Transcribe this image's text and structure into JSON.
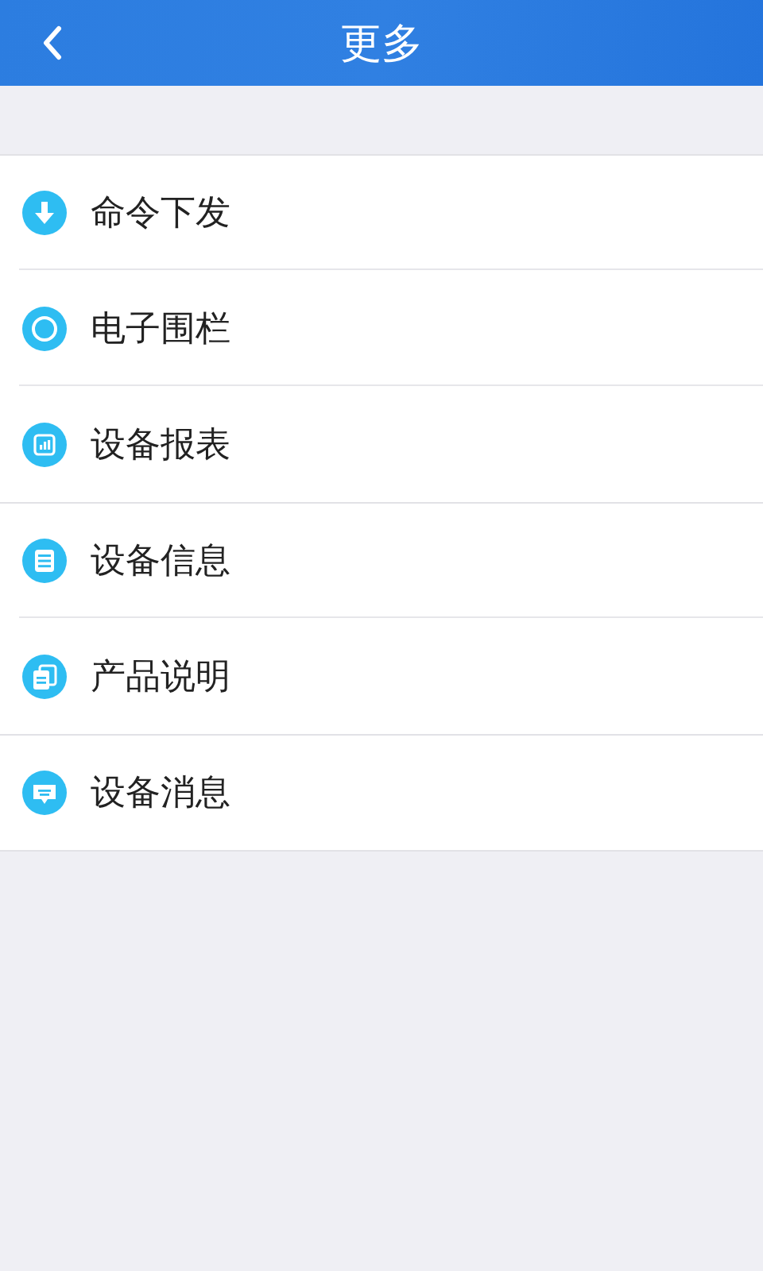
{
  "header": {
    "title": "更多"
  },
  "items": [
    {
      "kind": "download",
      "label": "命令下发",
      "divider_full": false
    },
    {
      "kind": "fence",
      "label": "电子围栏",
      "divider_full": false
    },
    {
      "kind": "report",
      "label": "设备报表",
      "divider_full": true
    },
    {
      "kind": "info",
      "label": "设备信息",
      "divider_full": false
    },
    {
      "kind": "manual",
      "label": "产品说明",
      "divider_full": true
    },
    {
      "kind": "message",
      "label": "设备消息",
      "divider_full": true
    }
  ]
}
